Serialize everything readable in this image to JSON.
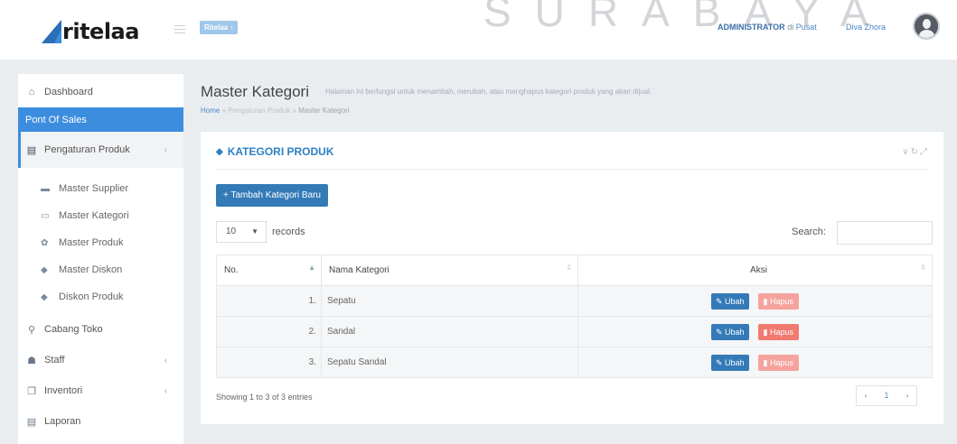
{
  "header": {
    "logo_text": "ritelaa",
    "branch_button": "Ritelaa",
    "watermark": "SURABAYA",
    "role": "ADMINISTRATOR",
    "role_sep": "di",
    "location": "Pusat",
    "user_name": "Diva Zhora"
  },
  "sidebar": {
    "items": [
      {
        "label": "Dashboard",
        "icon": "home-icon"
      },
      {
        "label": "Pont Of Sales",
        "icon": ""
      },
      {
        "label": "Pengaturan Produk",
        "icon": "list-icon"
      },
      {
        "label": "Cabang Toko",
        "icon": "map-marker-icon"
      },
      {
        "label": "Staff",
        "icon": "users-icon"
      },
      {
        "label": "Inventori",
        "icon": "copy-icon"
      },
      {
        "label": "Laporan",
        "icon": "file-icon"
      }
    ],
    "sub_items": [
      {
        "label": "Master Supplier",
        "icon": "truck-icon"
      },
      {
        "label": "Master Kategori",
        "icon": "folder-icon"
      },
      {
        "label": "Master Produk",
        "icon": "gift-icon"
      },
      {
        "label": "Master Diskon",
        "icon": "tags-icon"
      },
      {
        "label": "Diskon Produk",
        "icon": "tag-icon"
      }
    ]
  },
  "page": {
    "title": "Master Kategori",
    "description": "Halaman ini berfungsi untuk menambah, merubah, atau menghapus kategori produk yang akan dijual.",
    "breadcrumb": [
      "Home",
      "Pengaturan Produk",
      "Master Kategori"
    ]
  },
  "card": {
    "title": "KATEGORI PRODUK",
    "add_button": "Tambah Kategori Baru",
    "length_value": "10",
    "length_label": "records",
    "search_label": "Search:",
    "search_value": "",
    "columns": [
      "No.",
      "Nama Kategori",
      "Aksi"
    ],
    "rows": [
      {
        "no": "1.",
        "name": "Sepatu"
      },
      {
        "no": "2.",
        "name": "Sandal"
      },
      {
        "no": "3.",
        "name": "Sepatu Sandal"
      }
    ],
    "edit_label": "Ubah",
    "delete_label": "Hapus",
    "showing": "Showing 1 to 3 of 3 entries",
    "pager": {
      "prev": "‹",
      "current": "1",
      "next": "›"
    }
  },
  "colors": {
    "primary": "#337ab7",
    "sidebar_active": "#3c8dde",
    "danger": "#f07a70",
    "title_blue": "#2f7fc1"
  }
}
